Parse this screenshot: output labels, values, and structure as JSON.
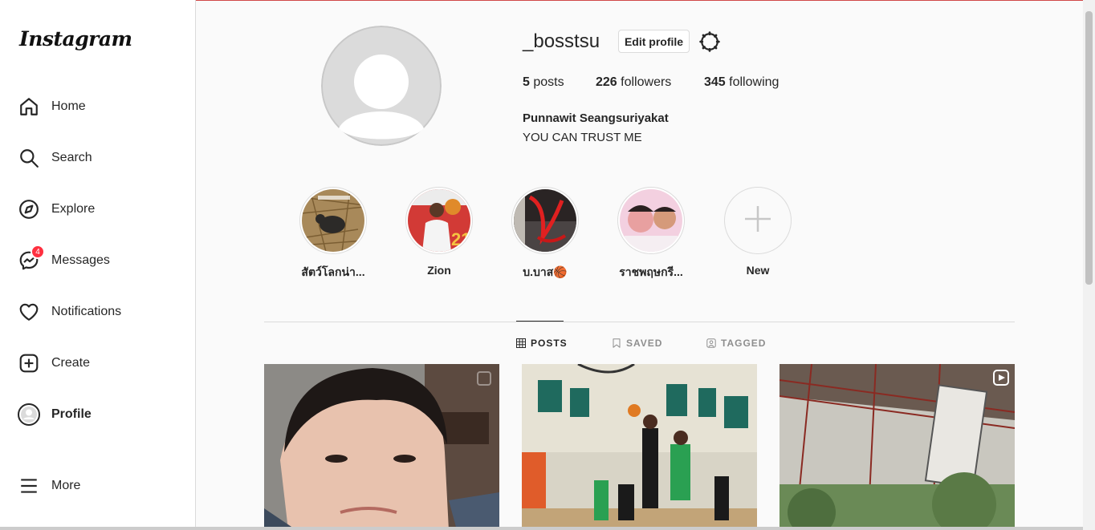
{
  "app": {
    "logo": "Instagram"
  },
  "sidebar": {
    "items": [
      {
        "label": "Home",
        "icon": "home-icon"
      },
      {
        "label": "Search",
        "icon": "search-icon"
      },
      {
        "label": "Explore",
        "icon": "compass-icon"
      },
      {
        "label": "Messages",
        "icon": "messenger-icon",
        "badge": "4"
      },
      {
        "label": "Notifications",
        "icon": "heart-icon"
      },
      {
        "label": "Create",
        "icon": "plus-square-icon"
      },
      {
        "label": "Profile",
        "icon": "avatar-icon"
      }
    ],
    "more": {
      "label": "More",
      "icon": "menu-icon"
    }
  },
  "profile": {
    "username": "_bosstsu",
    "edit_label": "Edit profile",
    "posts_count": "5",
    "posts_label": "posts",
    "followers_count": "226",
    "followers_label": "followers",
    "following_count": "345",
    "following_label": "following",
    "full_name": "Punnawit Seangsuriyakat",
    "bio": "YOU CAN TRUST ME"
  },
  "highlights": [
    {
      "label": "สัตว์โลกน่า..."
    },
    {
      "label": "Zion"
    },
    {
      "label": "บ.บาส🏀"
    },
    {
      "label": "ราชพฤษกรี..."
    },
    {
      "label": "New"
    }
  ],
  "tabs": [
    {
      "label": "POSTS",
      "icon": "grid-icon",
      "active": true
    },
    {
      "label": "SAVED",
      "icon": "bookmark-icon",
      "active": false
    },
    {
      "label": "TAGGED",
      "icon": "tagged-icon",
      "active": false
    }
  ],
  "colors": {
    "badge": "#ff3040",
    "border": "#dbdbdb",
    "text": "#262626"
  }
}
